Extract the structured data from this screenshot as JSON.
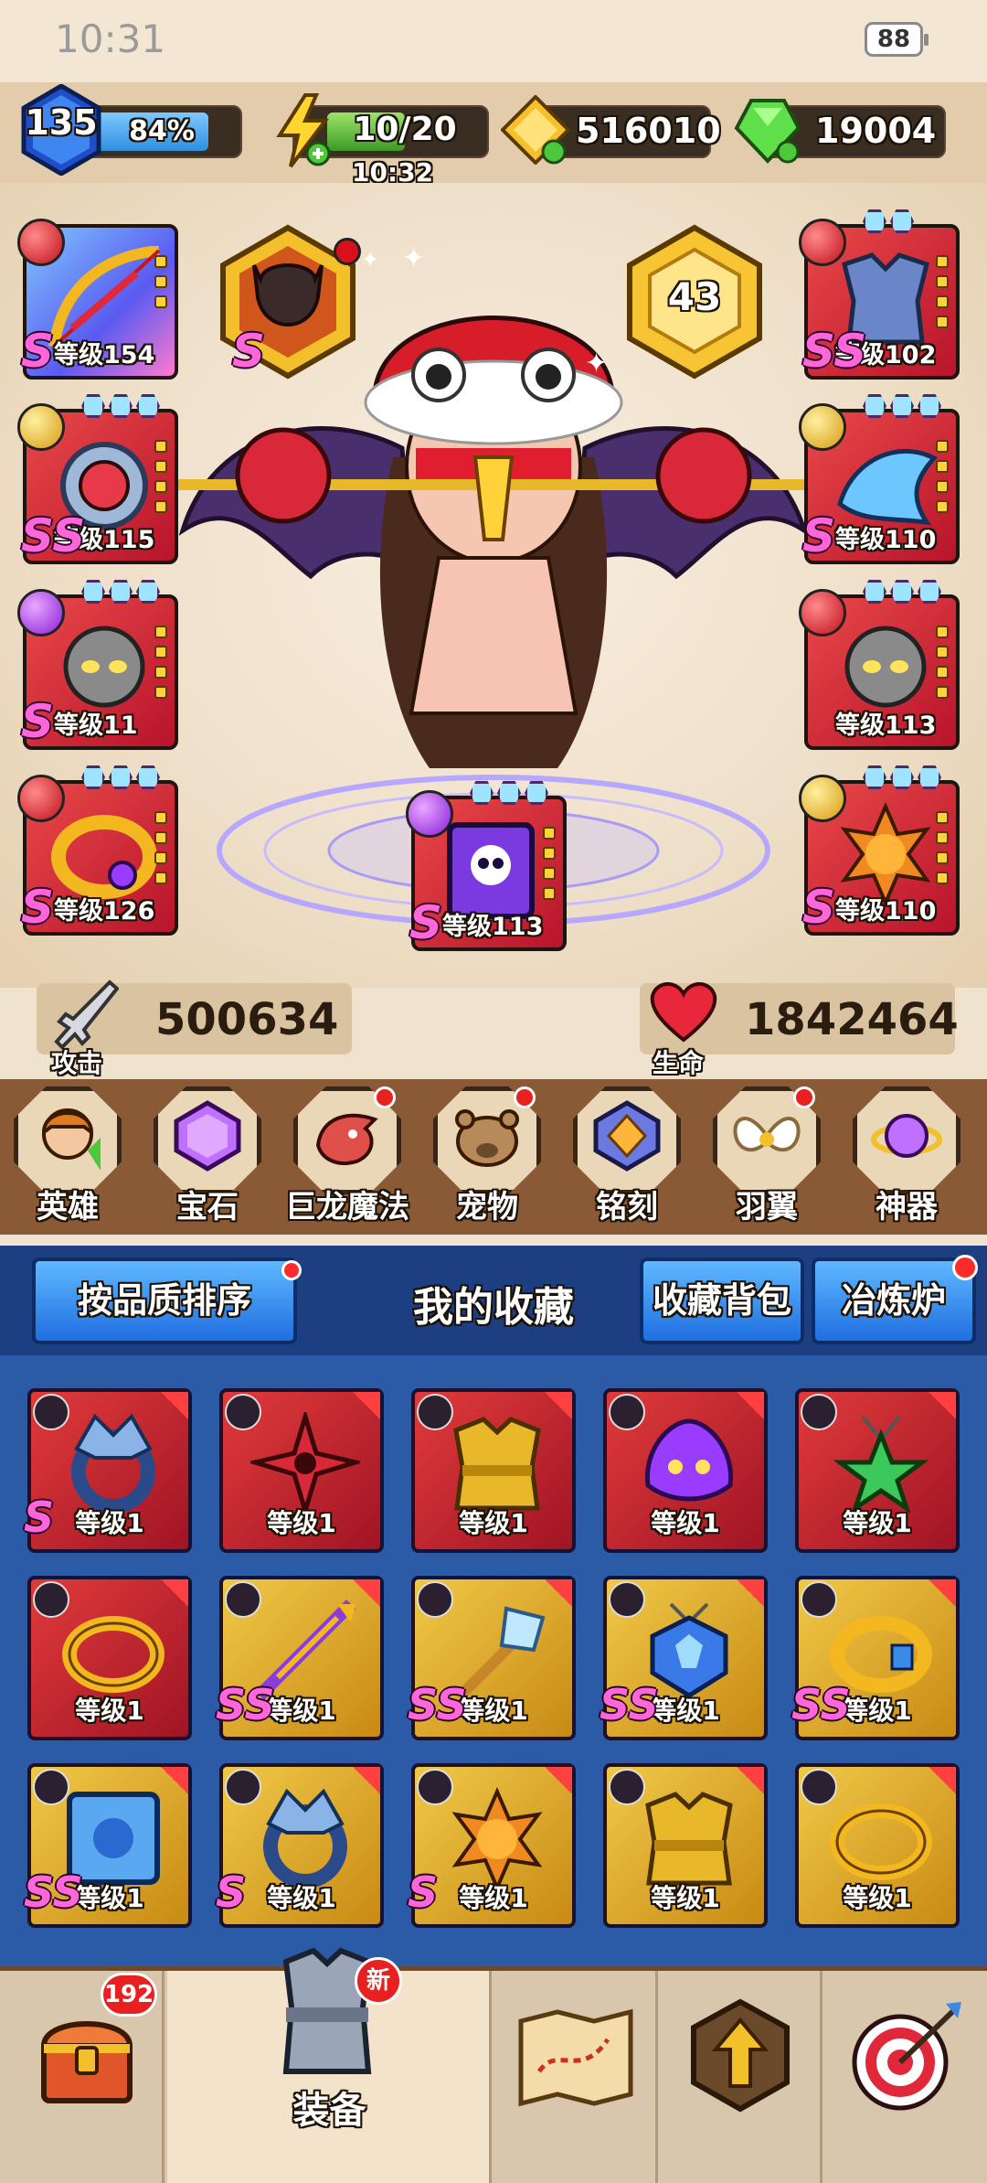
{
  "status": {
    "time": "10:31",
    "battery": "88"
  },
  "resources": {
    "player_level": "135",
    "xp_percent": "84%",
    "energy": "10/20",
    "energy_timer": "10:32",
    "gold": "516010",
    "gems": "19004"
  },
  "hero": {
    "rank_badge": "43",
    "attack_value": "500634",
    "attack_label": "攻击",
    "hp_value": "1842464",
    "hp_label": "生命",
    "slots": [
      {
        "name": "weapon",
        "label": "等级154",
        "rank": "S"
      },
      {
        "name": "helmet",
        "label": "",
        "rank": "S"
      },
      {
        "name": "armor",
        "label": "等级102",
        "rank": "SS"
      },
      {
        "name": "ring-left",
        "label": "等级115",
        "rank": "SS"
      },
      {
        "name": "bracer",
        "label": "等级110",
        "rank": "S"
      },
      {
        "name": "pet-left",
        "label": "等级11",
        "rank": "S"
      },
      {
        "name": "pet-right",
        "label": "等级113",
        "rank": ""
      },
      {
        "name": "bracelet",
        "label": "等级126",
        "rank": "S"
      },
      {
        "name": "spellbook",
        "label": "等级113",
        "rank": "S"
      },
      {
        "name": "amulet",
        "label": "等级110",
        "rank": "S"
      }
    ]
  },
  "tabs": [
    {
      "label": "英雄",
      "icon": "hero-icon",
      "dot": false
    },
    {
      "label": "宝石",
      "icon": "gem-icon",
      "dot": false
    },
    {
      "label": "巨龙魔法",
      "icon": "dragon-icon",
      "dot": true
    },
    {
      "label": "宠物",
      "icon": "pet-icon",
      "dot": true
    },
    {
      "label": "铭刻",
      "icon": "inscription-icon",
      "dot": false
    },
    {
      "label": "羽翼",
      "icon": "wings-icon",
      "dot": true
    },
    {
      "label": "神器",
      "icon": "artifact-icon",
      "dot": false
    }
  ],
  "collection": {
    "sort_label": "按品质排序",
    "title": "我的收藏",
    "bag_label": "收藏背包",
    "forge_label": "冶炼炉",
    "items": [
      {
        "label": "等级1",
        "rank": "S",
        "row": "red",
        "icon": "dragon-ring-icon"
      },
      {
        "label": "等级1",
        "rank": "",
        "row": "red",
        "icon": "shuriken-icon"
      },
      {
        "label": "等级1",
        "rank": "",
        "row": "red",
        "icon": "gold-armor-icon"
      },
      {
        "label": "等级1",
        "rank": "",
        "row": "red",
        "icon": "purple-pet-icon"
      },
      {
        "label": "等级1",
        "rank": "",
        "row": "red",
        "icon": "star-amulet-icon"
      },
      {
        "label": "等级1",
        "rank": "",
        "row": "red",
        "icon": "gold-bracelet-icon"
      },
      {
        "label": "等级1",
        "rank": "SS",
        "row": "gold",
        "icon": "purple-bow-icon"
      },
      {
        "label": "等级1",
        "rank": "SS",
        "row": "gold",
        "icon": "crystal-staff-icon"
      },
      {
        "label": "等级1",
        "rank": "SS",
        "row": "gold",
        "icon": "wolf-amulet-icon"
      },
      {
        "label": "等级1",
        "rank": "SS",
        "row": "gold",
        "icon": "gem-bracelet-icon"
      },
      {
        "label": "等级1",
        "rank": "SS",
        "row": "gold",
        "icon": "blue-book-icon"
      },
      {
        "label": "等级1",
        "rank": "S",
        "row": "gold",
        "icon": "dragon-ring-icon"
      },
      {
        "label": "等级1",
        "rank": "S",
        "row": "gold",
        "icon": "sun-amulet-icon"
      },
      {
        "label": "等级1",
        "rank": "",
        "row": "gold",
        "icon": "gold-armor-icon"
      },
      {
        "label": "等级1",
        "rank": "",
        "row": "gold",
        "icon": "gold-bracelet-icon"
      }
    ]
  },
  "nav": {
    "chest_badge": "192",
    "equip_badge": "新",
    "equip_label": "装备"
  },
  "colors": {
    "panel_blue": "#2b5aa6",
    "accent_gold": "#f0c848",
    "accent_red": "#e03b3b"
  }
}
